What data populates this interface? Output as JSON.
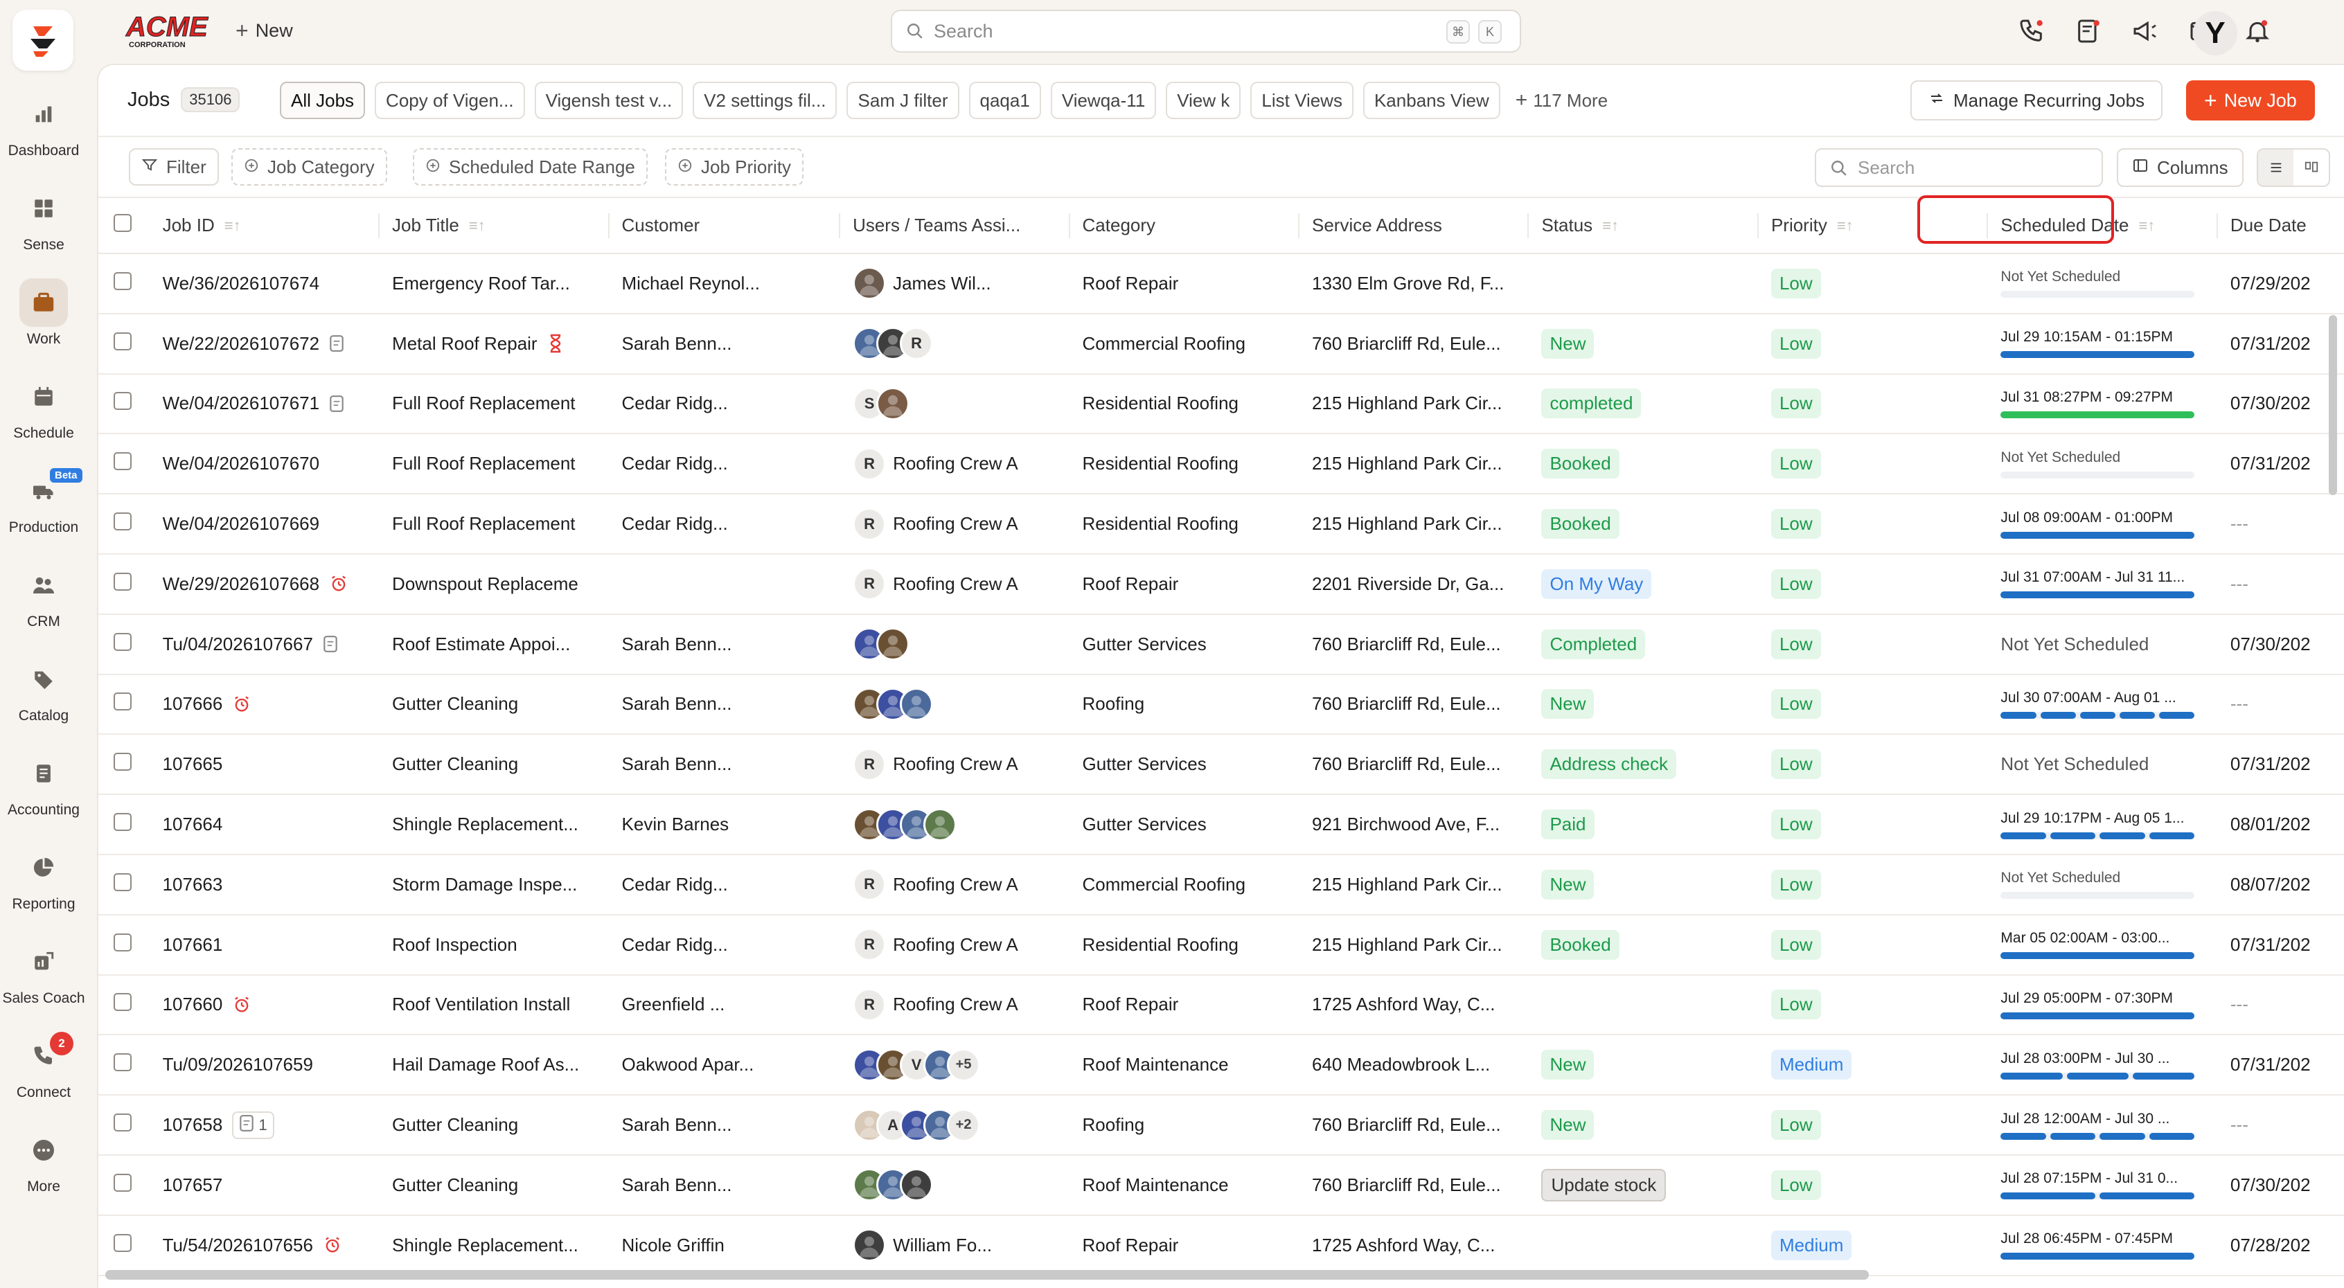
{
  "brand": {
    "company_logo_text": "ACME",
    "company_logo_subtext": "CORPORATION",
    "accent": "#f04a22"
  },
  "topbar": {
    "new_label": "New",
    "search_placeholder": "Search",
    "shortcut_keys": [
      "⌘",
      "K"
    ],
    "user_initial": "Y"
  },
  "sidebar": {
    "items": [
      {
        "label": "Dashboard",
        "icon": "bar-chart-icon"
      },
      {
        "label": "Sense",
        "icon": "grid-icon"
      },
      {
        "label": "Work",
        "icon": "briefcase-icon",
        "active": true
      },
      {
        "label": "Schedule",
        "icon": "calendar-icon"
      },
      {
        "label": "Production",
        "icon": "truck-icon",
        "badge": "Beta"
      },
      {
        "label": "CRM",
        "icon": "people-icon"
      },
      {
        "label": "Catalog",
        "icon": "tag-icon"
      },
      {
        "label": "Accounting",
        "icon": "ledger-icon"
      },
      {
        "label": "Reporting",
        "icon": "pie-chart-icon"
      },
      {
        "label": "Sales Coach",
        "icon": "coach-icon"
      },
      {
        "label": "Connect",
        "icon": "phone-icon",
        "count": "2"
      },
      {
        "label": "More",
        "icon": "more-icon"
      }
    ]
  },
  "views": {
    "title": "Jobs",
    "count": "35106",
    "tabs": [
      "All Jobs",
      "Copy of Vigen...",
      "Vigensh test v...",
      "V2 settings fil...",
      "Sam J filter",
      "qaqa1",
      "Viewqa-11",
      "View k",
      "List Views",
      "Kanbans View"
    ],
    "more": "117 More",
    "manage_recurring": "Manage Recurring Jobs",
    "new_job": "New Job"
  },
  "filters": {
    "filter": "Filter",
    "job_category": "Job Category",
    "scheduled_date_range": "Scheduled Date Range",
    "job_priority": "Job Priority",
    "search_placeholder": "Search",
    "columns": "Columns"
  },
  "table": {
    "columns": [
      "Job ID",
      "Job Title",
      "Customer",
      "Users / Teams Assi...",
      "Category",
      "Service Address",
      "Status",
      "Priority",
      "Scheduled Date",
      "Due Date"
    ],
    "rows": [
      {
        "id": "We/36/2026107674",
        "title": "Emergency Roof Tar...",
        "customer": "Michael Reynol...",
        "avatars": [
          {
            "c": "#6b5a4e"
          }
        ],
        "assignee": "James Wil...",
        "category": "Roof Repair",
        "address": "1330 Elm Grove Rd, F...",
        "status": "",
        "status_color": "",
        "priority": "Low",
        "priority_color": "green",
        "sched": "Not Yet Scheduled",
        "sched_style": "small-muted",
        "bar": [],
        "due": "07/29/202"
      },
      {
        "id": "We/22/2026107672",
        "id_icon": "note-icon",
        "title": "Metal Roof Repair",
        "title_icon": "hourglass-icon",
        "customer": "Sarah Benn...",
        "avatars": [
          {
            "c": "#4b6a9b"
          },
          {
            "c": "#3e3e3e"
          },
          {
            "l": "R"
          }
        ],
        "assignee": "",
        "category": "Commercial Roofing",
        "address": "760 Briarcliff Rd, Eule...",
        "status": "New",
        "status_color": "green",
        "priority": "Low",
        "priority_color": "green",
        "sched": "Jul 29 10:15AM - 01:15PM",
        "sched_style": "small",
        "bar": [
          "#1f6fc4"
        ],
        "due": "07/31/202"
      },
      {
        "id": "We/04/2026107671",
        "id_icon": "note-icon",
        "title": "Full Roof Replacement",
        "customer": "Cedar Ridg...",
        "avatars": [
          {
            "l": "S"
          },
          {
            "c": "#7a5b45"
          }
        ],
        "assignee": "",
        "category": "Residential Roofing",
        "address": "215 Highland Park Cir...",
        "status": "completed",
        "status_color": "green",
        "priority": "Low",
        "priority_color": "green",
        "sched": "Jul 31 08:27PM - 09:27PM",
        "sched_style": "small",
        "bar": [
          "#2fbf5a"
        ],
        "due": "07/30/202"
      },
      {
        "id": "We/04/2026107670",
        "title": "Full Roof Replacement",
        "customer": "Cedar Ridg...",
        "avatars": [
          {
            "l": "R"
          }
        ],
        "assignee": "Roofing Crew A",
        "category": "Residential Roofing",
        "address": "215 Highland Park Cir...",
        "status": "Booked",
        "status_color": "green",
        "priority": "Low",
        "priority_color": "green",
        "sched": "Not Yet Scheduled",
        "sched_style": "small-muted",
        "bar": [],
        "due": "07/31/202"
      },
      {
        "id": "We/04/2026107669",
        "title": "Full Roof Replacement",
        "customer": "Cedar Ridg...",
        "avatars": [
          {
            "l": "R"
          }
        ],
        "assignee": "Roofing Crew A",
        "category": "Residential Roofing",
        "address": "215 Highland Park Cir...",
        "status": "Booked",
        "status_color": "green",
        "priority": "Low",
        "priority_color": "green",
        "sched": "Jul 08 09:00AM - 01:00PM",
        "sched_style": "small",
        "bar": [
          "#1f6fc4"
        ],
        "due": "---"
      },
      {
        "id": "We/29/2026107668",
        "id_icon": "alarm-icon",
        "title": "Downspout Replaceme",
        "customer": "",
        "avatars": [
          {
            "l": "R"
          }
        ],
        "assignee": "Roofing Crew A",
        "category": "Roof Repair",
        "address": "2201 Riverside Dr, Ga...",
        "status": "On My Way",
        "status_color": "blue",
        "priority": "Low",
        "priority_color": "green",
        "sched": "Jul 31 07:00AM - Jul 31 11...",
        "sched_style": "small",
        "bar": [
          "#1f6fc4"
        ],
        "due": "---"
      },
      {
        "id": "Tu/04/2026107667",
        "id_icon": "note-icon",
        "title": "Roof Estimate Appoi...",
        "customer": "Sarah Benn...",
        "avatars": [
          {
            "c": "#3c4fa0"
          },
          {
            "c": "#6a5032"
          }
        ],
        "assignee": "",
        "category": "Gutter Services",
        "address": "760 Briarcliff Rd, Eule...",
        "status": "Completed",
        "status_color": "green",
        "priority": "Low",
        "priority_color": "green",
        "sched": "Not Yet Scheduled",
        "sched_style": "big",
        "bar": null,
        "due": "07/30/202"
      },
      {
        "id": "107666",
        "id_icon": "alarm-icon",
        "title": "Gutter Cleaning",
        "customer": "Sarah Benn...",
        "avatars": [
          {
            "c": "#6a5032"
          },
          {
            "c": "#3c4fa0"
          },
          {
            "c": "#4b6a9b"
          }
        ],
        "assignee": "",
        "category": "Roofing",
        "address": "760 Briarcliff Rd, Eule...",
        "status": "New",
        "status_color": "green",
        "priority": "Low",
        "priority_color": "green",
        "sched": "Jul 30 07:00AM - Aug 01 ...",
        "sched_style": "small",
        "bar": [
          "#1f6fc4",
          "#1f6fc4",
          "#1f6fc4",
          "#1f6fc4",
          "#1f6fc4"
        ],
        "due": "---"
      },
      {
        "id": "107665",
        "title": "Gutter Cleaning",
        "customer": "Sarah Benn...",
        "avatars": [
          {
            "l": "R"
          }
        ],
        "assignee": "Roofing Crew A",
        "category": "Gutter Services",
        "address": "760 Briarcliff Rd, Eule...",
        "status": "Address check",
        "status_color": "green",
        "priority": "Low",
        "priority_color": "green",
        "sched": "Not Yet Scheduled",
        "sched_style": "big",
        "bar": null,
        "due": "07/31/202"
      },
      {
        "id": "107664",
        "title": "Shingle Replacement...",
        "customer": "Kevin Barnes",
        "avatars": [
          {
            "c": "#6a5032"
          },
          {
            "c": "#3c4fa0"
          },
          {
            "c": "#4b6a9b"
          },
          {
            "c": "#5c7a4a"
          }
        ],
        "assignee": "",
        "category": "Gutter Services",
        "address": "921 Birchwood Ave, F...",
        "status": "Paid",
        "status_color": "green",
        "priority": "Low",
        "priority_color": "green",
        "sched": "Jul 29 10:17PM - Aug 05 1...",
        "sched_style": "small",
        "bar": [
          "#1f6fc4",
          "#1f6fc4",
          "#1f6fc4",
          "#1f6fc4"
        ],
        "due": "08/01/202"
      },
      {
        "id": "107663",
        "title": "Storm Damage Inspe...",
        "customer": "Cedar Ridg...",
        "avatars": [
          {
            "l": "R"
          }
        ],
        "assignee": "Roofing Crew A",
        "category": "Commercial Roofing",
        "address": "215 Highland Park Cir...",
        "status": "New",
        "status_color": "green",
        "priority": "Low",
        "priority_color": "green",
        "sched": "Not Yet Scheduled",
        "sched_style": "small-muted",
        "bar": [],
        "due": "08/07/202"
      },
      {
        "id": "107661",
        "title": "Roof Inspection",
        "customer": "Cedar Ridg...",
        "avatars": [
          {
            "l": "R"
          }
        ],
        "assignee": "Roofing Crew A",
        "category": "Residential Roofing",
        "address": "215 Highland Park Cir...",
        "status": "Booked",
        "status_color": "green",
        "priority": "Low",
        "priority_color": "green",
        "sched": "Mar 05 02:00AM - 03:00...",
        "sched_style": "small",
        "bar": [
          "#1f6fc4"
        ],
        "due": "07/31/202"
      },
      {
        "id": "107660",
        "id_icon": "alarm-icon",
        "title": "Roof Ventilation Install",
        "customer": "Greenfield ...",
        "avatars": [
          {
            "l": "R"
          }
        ],
        "assignee": "Roofing Crew A",
        "category": "Roof Repair",
        "address": "1725 Ashford Way, C...",
        "status": "",
        "status_color": "",
        "priority": "Low",
        "priority_color": "green",
        "sched": "Jul 29 05:00PM - 07:30PM",
        "sched_style": "small",
        "bar": [
          "#1f6fc4"
        ],
        "due": "---"
      },
      {
        "id": "Tu/09/2026107659",
        "title": "Hail Damage Roof As...",
        "customer": "Oakwood Apar...",
        "avatars": [
          {
            "c": "#3c4fa0"
          },
          {
            "c": "#6a5032"
          },
          {
            "l": "V"
          },
          {
            "c": "#4b6a9b"
          },
          {
            "l": "+5",
            "more": true
          }
        ],
        "assignee": "",
        "category": "Roof Maintenance",
        "address": "640 Meadowbrook L...",
        "status": "New",
        "status_color": "green",
        "priority": "Medium",
        "priority_color": "blue",
        "sched": "Jul 28 03:00PM - Jul 30 ...",
        "sched_style": "small",
        "bar": [
          "#1f6fc4",
          "#1f6fc4",
          "#1f6fc4"
        ],
        "due": "07/31/202"
      },
      {
        "id": "107658",
        "id_pill": "1",
        "title": "Gutter Cleaning",
        "customer": "Sarah Benn...",
        "avatars": [
          {
            "c": "#d8c9b8"
          },
          {
            "l": "A"
          },
          {
            "c": "#3c4fa0"
          },
          {
            "c": "#4b6a9b"
          },
          {
            "l": "+2",
            "more": true
          }
        ],
        "assignee": "",
        "category": "Roofing",
        "address": "760 Briarcliff Rd, Eule...",
        "status": "New",
        "status_color": "green",
        "priority": "Low",
        "priority_color": "green",
        "sched": "Jul 28 12:00AM - Jul 30 ...",
        "sched_style": "small",
        "bar": [
          "#1f6fc4",
          "#1f6fc4",
          "#1f6fc4",
          "#1f6fc4"
        ],
        "due": "---"
      },
      {
        "id": "107657",
        "title": "Gutter Cleaning",
        "customer": "Sarah Benn...",
        "avatars": [
          {
            "c": "#5c7a4a"
          },
          {
            "c": "#4b6a9b"
          },
          {
            "c": "#3e3e3e"
          }
        ],
        "assignee": "",
        "category": "Roof Maintenance",
        "address": "760 Briarcliff Rd, Eule...",
        "status": "Update stock",
        "status_color": "gray",
        "priority": "Low",
        "priority_color": "green",
        "sched": "Jul 28 07:15PM - Jul 31 0...",
        "sched_style": "small",
        "bar": [
          "#1f6fc4",
          "#1f6fc4"
        ],
        "due": "07/30/202"
      },
      {
        "id": "Tu/54/2026107656",
        "id_icon": "alarm-icon",
        "title": "Shingle Replacement...",
        "customer": "Nicole Griffin",
        "avatars": [
          {
            "c": "#3e3e3e"
          }
        ],
        "assignee": "William Fo...",
        "category": "Roof Repair",
        "address": "1725 Ashford Way, C...",
        "status": "",
        "status_color": "",
        "priority": "Medium",
        "priority_color": "blue",
        "sched": "Jul 28 06:45PM - 07:45PM",
        "sched_style": "small",
        "bar": [
          "#1f6fc4"
        ],
        "due": "07/28/202"
      }
    ]
  }
}
